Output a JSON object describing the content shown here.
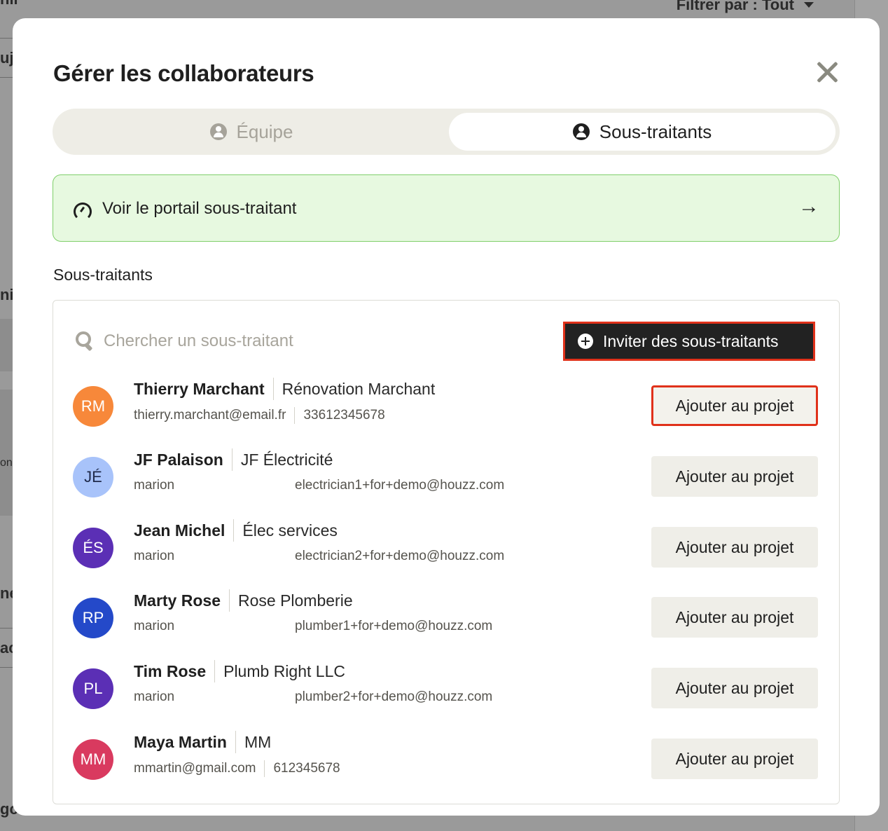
{
  "background": {
    "filter_label": "Filtrer par : Tout",
    "fragments": [
      "nil",
      "uj",
      "nie",
      "on",
      "ne",
      "ac",
      "gc"
    ]
  },
  "modal": {
    "title": "Gérer les collaborateurs",
    "close_icon": "close-icon",
    "tabs": [
      {
        "label": "Équipe",
        "icon": "team-icon",
        "selected": false
      },
      {
        "label": "Sous-traitants",
        "icon": "person-icon",
        "selected": true
      }
    ],
    "portal_banner": {
      "label": "Voir le portail sous-traitant",
      "icon": "gauge-icon",
      "arrow": "→"
    },
    "section_label": "Sous-traitants",
    "search": {
      "placeholder": "Chercher un sous-traitant",
      "value": ""
    },
    "invite_button": "Inviter des sous-traitants",
    "add_button_label": "Ajouter au projet",
    "subcontractors": [
      {
        "initials": "RM",
        "color": "#f7883a",
        "name": "Thierry Marchant",
        "company": "Rénovation Marchant",
        "email": "thierry.marchant@email.fr",
        "phone": "33612345678",
        "email_split": ""
      },
      {
        "initials": "JÉ",
        "color": "#a8c3fa",
        "name": "JF Palaison",
        "company": "JF Électricité",
        "email": "marion",
        "phone": "",
        "email_split": "electrician1+for+demo@houzz.com"
      },
      {
        "initials": "ÉS",
        "color": "#5b2fb5",
        "name": "Jean Michel",
        "company": "Élec services",
        "email": "marion",
        "phone": "",
        "email_split": "electrician2+for+demo@houzz.com"
      },
      {
        "initials": "RP",
        "color": "#2449c9",
        "name": "Marty Rose",
        "company": "Rose Plomberie",
        "email": "marion",
        "phone": "",
        "email_split": "plumber1+for+demo@houzz.com"
      },
      {
        "initials": "PL",
        "color": "#5b2fb5",
        "name": "Tim Rose",
        "company": "Plumb Right LLC",
        "email": "marion",
        "phone": "",
        "email_split": "plumber2+for+demo@houzz.com"
      },
      {
        "initials": "MM",
        "color": "#d93a5f",
        "name": "Maya Martin",
        "company": "MM",
        "email": "mmartin@gmail.com",
        "phone": "612345678",
        "email_split": ""
      }
    ]
  }
}
